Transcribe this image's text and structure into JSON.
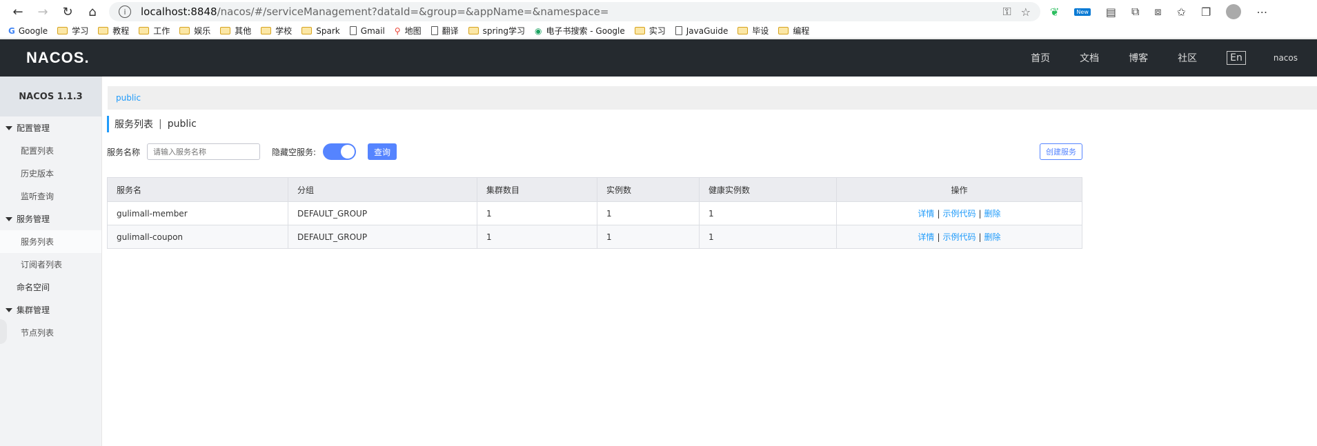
{
  "browser": {
    "url_host": "localhost:8848",
    "url_path": "/nacos/#/serviceManagement?dataId=&group=&appName=&namespace=",
    "ext_new_badge": "New"
  },
  "bookmarks": [
    {
      "label": "Google",
      "type": "google"
    },
    {
      "label": "学习",
      "type": "folder"
    },
    {
      "label": "教程",
      "type": "folder"
    },
    {
      "label": "工作",
      "type": "folder"
    },
    {
      "label": "娱乐",
      "type": "folder"
    },
    {
      "label": "其他",
      "type": "folder"
    },
    {
      "label": "学校",
      "type": "folder"
    },
    {
      "label": "Spark",
      "type": "folder"
    },
    {
      "label": "Gmail",
      "type": "page"
    },
    {
      "label": "地图",
      "type": "map"
    },
    {
      "label": "翻译",
      "type": "page"
    },
    {
      "label": "spring学习",
      "type": "folder"
    },
    {
      "label": "电子书搜索 - Google",
      "type": "ebook"
    },
    {
      "label": "实习",
      "type": "folder"
    },
    {
      "label": "JavaGuide",
      "type": "page"
    },
    {
      "label": "毕设",
      "type": "folder"
    },
    {
      "label": "编程",
      "type": "folder"
    }
  ],
  "topnav": {
    "logo": "NACOS.",
    "links": [
      "首页",
      "文档",
      "博客",
      "社区"
    ],
    "lang": "En",
    "user": "nacos"
  },
  "sidebar": {
    "version": "NACOS 1.1.3",
    "items": [
      {
        "label": "配置管理",
        "kind": "group"
      },
      {
        "label": "配置列表",
        "kind": "sub"
      },
      {
        "label": "历史版本",
        "kind": "sub"
      },
      {
        "label": "监听查询",
        "kind": "sub"
      },
      {
        "label": "服务管理",
        "kind": "group"
      },
      {
        "label": "服务列表",
        "kind": "sub",
        "active": true
      },
      {
        "label": "订阅者列表",
        "kind": "sub"
      },
      {
        "label": "命名空间",
        "kind": "plain"
      },
      {
        "label": "集群管理",
        "kind": "group"
      },
      {
        "label": "节点列表",
        "kind": "sub"
      }
    ]
  },
  "main": {
    "namespace_tab": "public",
    "title": "服务列表",
    "title_sep": "|",
    "title_ns": "public",
    "search_label": "服务名称",
    "search_placeholder": "请输入服务名称",
    "hide_empty_label": "隐藏空服务:",
    "hide_empty_on": true,
    "query_button": "查询",
    "create_button": "创建服务",
    "columns": [
      "服务名",
      "分组",
      "集群数目",
      "实例数",
      "健康实例数",
      "操作"
    ],
    "rows": [
      {
        "name": "gulimall-member",
        "group": "DEFAULT_GROUP",
        "clusters": "1",
        "instances": "1",
        "healthy": "1"
      },
      {
        "name": "gulimall-coupon",
        "group": "DEFAULT_GROUP",
        "clusters": "1",
        "instances": "1",
        "healthy": "1"
      }
    ],
    "ops": {
      "detail": "详情",
      "sample": "示例代码",
      "delete": "删除",
      "sep": "|"
    }
  },
  "colors": {
    "accent": "#5584ff",
    "link": "#209bfa",
    "topbar": "#252a2f"
  }
}
